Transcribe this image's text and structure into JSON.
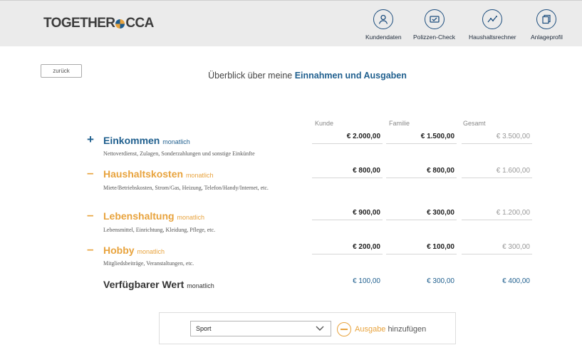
{
  "header": {
    "logo_left": "TOGETHER",
    "logo_right": "CCA",
    "nav": [
      {
        "label": "Kundendaten",
        "icon": "user-icon"
      },
      {
        "label": "Polizzen-Check",
        "icon": "policy-check-icon"
      },
      {
        "label": "Haushaltsrechner",
        "icon": "line-chart-icon"
      },
      {
        "label": "Anlageprofil",
        "icon": "document-stack-icon"
      }
    ]
  },
  "back_label": "zurück",
  "title": {
    "prefix": "Überblick über meine",
    "highlight": "Einnahmen und Ausgaben"
  },
  "columns": {
    "kunde": "Kunde",
    "familie": "Familie",
    "gesamt": "Gesamt"
  },
  "rows": [
    {
      "sign": "+",
      "name": "Einkommen",
      "period": "monatlich",
      "description": "Nettoverdienst, Zulagen, Sonderzahlungen und sonstige Einkünfte",
      "kunde": "€ 2.000,00",
      "familie": "€ 1.500,00",
      "gesamt": "€ 3.500,00"
    },
    {
      "sign": "–",
      "name": "Haushaltskosten",
      "period": "monatlich",
      "description": "Miete/Betriebskosten, Strom/Gas, Heizung, Telefon/Handy/Internet, etc.",
      "kunde": "€ 800,00",
      "familie": "€ 800,00",
      "gesamt": "€ 1.600,00"
    },
    {
      "sign": "–",
      "name": "Lebenshaltung",
      "period": "monatlich",
      "description": "Lebensmittel, Einrichtung, Kleidung, Pflege, etc.",
      "kunde": "€ 900,00",
      "familie": "€ 300,00",
      "gesamt": "€ 1.200,00"
    },
    {
      "sign": "–",
      "name": "Hobby",
      "period": "monatlich",
      "description": "Mitgliedsbeiträge, Veranstaltungen, etc.",
      "kunde": "€ 200,00",
      "familie": "€ 100,00",
      "gesamt": "€ 300,00"
    }
  ],
  "available": {
    "name": "Verfügbarer Wert",
    "period": "monatlich",
    "kunde": "€ 100,00",
    "familie": "€ 300,00",
    "gesamt": "€ 400,00"
  },
  "add_expense": {
    "selected": "Sport",
    "button_highlight": "Ausgabe",
    "button_rest": "hinzufügen"
  },
  "colors": {
    "primary": "#1f5f8e",
    "accent": "#e8a33d",
    "header_bg": "#ebebeb"
  }
}
